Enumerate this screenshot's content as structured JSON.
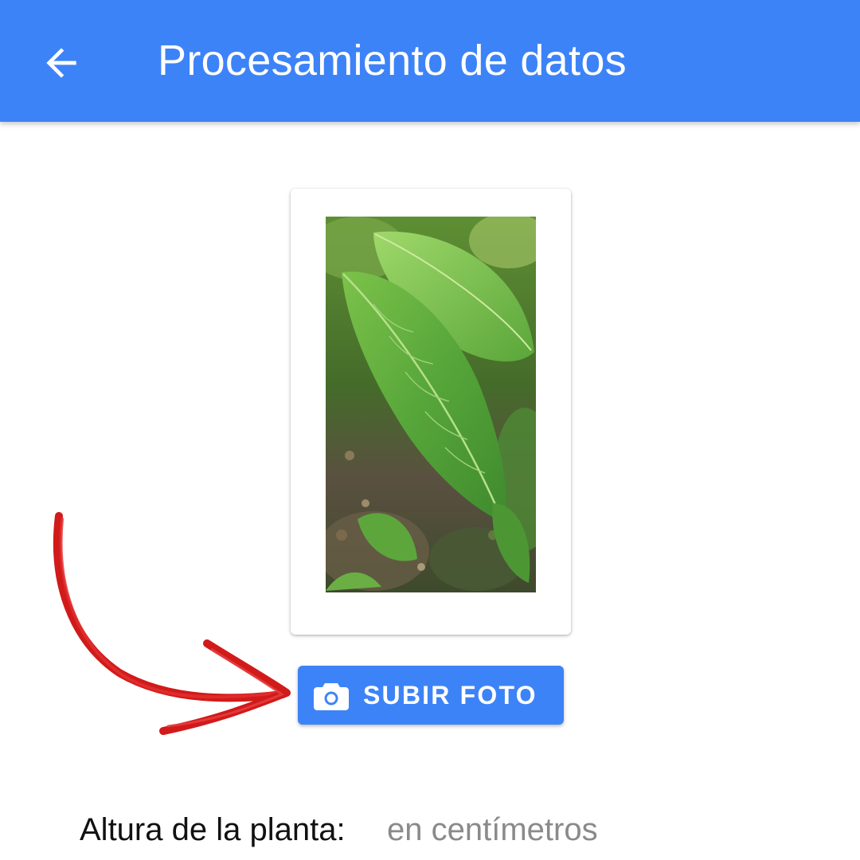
{
  "app_bar": {
    "title": "Procesamiento de datos",
    "back_icon": "arrow-left-icon",
    "color": "#3d83f8"
  },
  "photo": {
    "subject": "plant-leaf-photo"
  },
  "upload_button": {
    "label": "SUBIR FOTO",
    "icon": "camera-icon",
    "color": "#3d83f8"
  },
  "annotation": {
    "icon": "red-hand-drawn-arrow",
    "color": "#d11a1a"
  },
  "height_field": {
    "label": "Altura de la planta:",
    "value": "",
    "placeholder": "en centímetros"
  }
}
